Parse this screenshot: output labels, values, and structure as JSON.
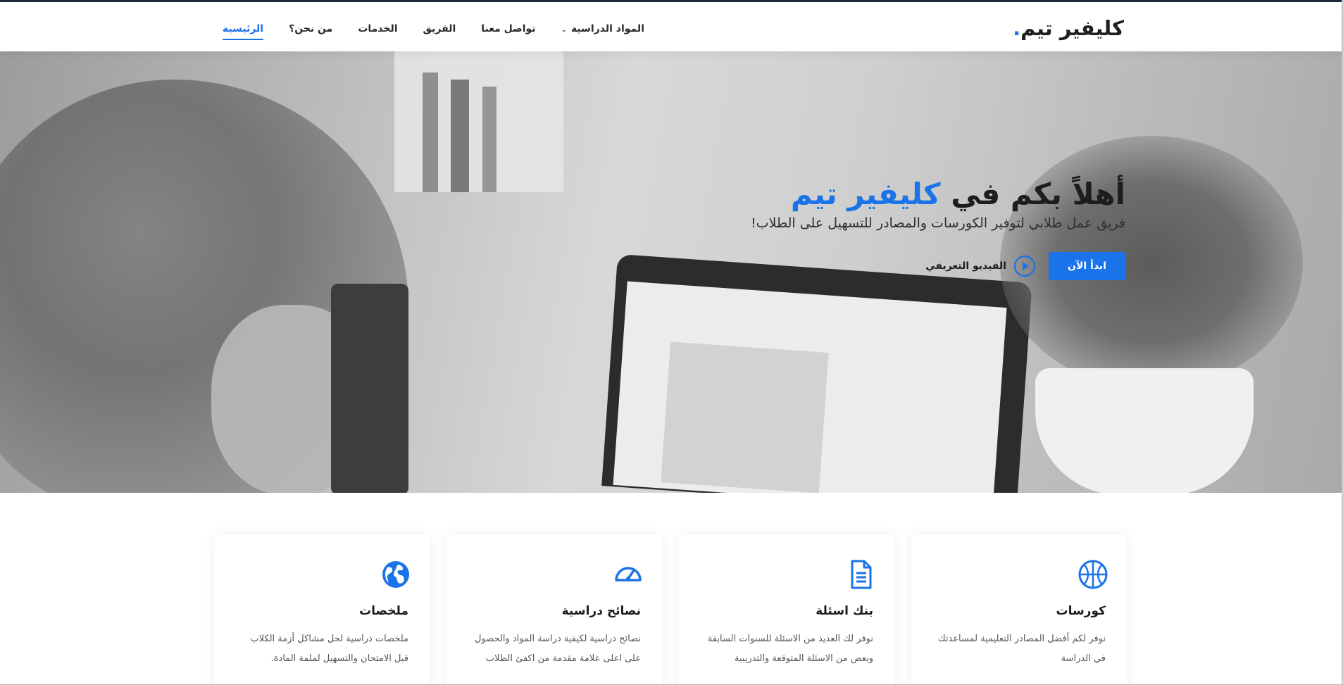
{
  "brand": {
    "name": "كليفير تيم",
    "dot": ".",
    "accent_color": "#1a73e8"
  },
  "nav": {
    "items": [
      {
        "label": "الرئيسية",
        "active": true
      },
      {
        "label": "من نحن؟",
        "active": false
      },
      {
        "label": "الخدمات",
        "active": false
      },
      {
        "label": "الفريق",
        "active": false
      },
      {
        "label": "تواصل معنا",
        "active": false
      },
      {
        "label": "المواد الدراسية",
        "active": false,
        "has_dropdown": true
      }
    ]
  },
  "hero": {
    "title_prefix": "أهلاً بكم في",
    "title_accent": "كليفير تيم",
    "subtitle": "فريق عمل طلابي لتوفير الكورسات والمصادر للتسهيل على الطلاب!",
    "primary_button": "ابدأ الآن",
    "video_link": "الفيديو التعريفي",
    "video_icon": "play-circle-icon"
  },
  "features": [
    {
      "icon": "basketball-icon",
      "title": "كورسات",
      "desc": "نوفر لكم أفضل المصادر التعليمية لمساعدتك في الدراسة"
    },
    {
      "icon": "document-icon",
      "title": "بنك اسئلة",
      "desc": "نوفر لك العديد من الاسئلة للسنوات السابقة وبعض من الاسئلة المتوقعة والتدريبية"
    },
    {
      "icon": "speedometer-icon",
      "title": "نصائح دراسية",
      "desc": "نصائح دراسية لكيفية دراسة المواد والحصول على اعلى علامة مقدمة من اكفئ الطلاب"
    },
    {
      "icon": "globe-icon",
      "title": "ملخصات",
      "desc": "ملخصات دراسية لحل مشاكل أزمة الكلاب قبل الامتحان والتسهيل لملمة المادة."
    }
  ]
}
